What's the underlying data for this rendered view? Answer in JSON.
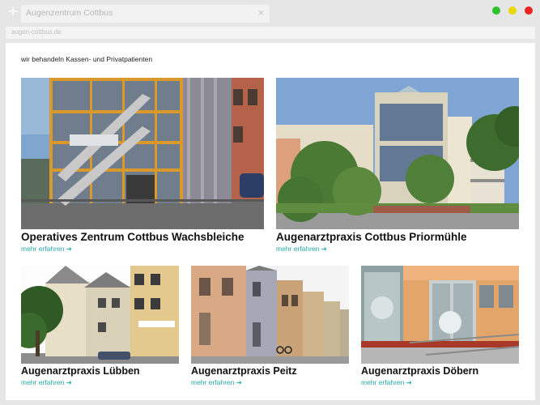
{
  "browser": {
    "new_tab_icon": "+",
    "tab_title": "Augenzentrum Cottbus",
    "tab_close_icon": "×",
    "url": "augen-cottbus.de",
    "window_controls": {
      "green": "#2ec22e",
      "yellow": "#e8d800",
      "red": "#ee2222"
    }
  },
  "page": {
    "tagline": "wir behandeln Kassen- und Privatpatienten",
    "accent_color": "#29a8a8",
    "locations": [
      {
        "title": "Operatives Zentrum Cottbus Wachsbleiche",
        "link": "mehr erfahren ➔"
      },
      {
        "title": "Augenarztpraxis Cottbus Priormühle",
        "link": "mehr erfahren ➔"
      },
      {
        "title": "Augenarztpraxis Lübben",
        "link": "mehr erfahren ➔"
      },
      {
        "title": "Augenarztpraxis Peitz",
        "link": "mehr erfahren ➔"
      },
      {
        "title": "Augenarztpraxis Döbern",
        "link": "mehr erfahren ➔"
      }
    ]
  }
}
